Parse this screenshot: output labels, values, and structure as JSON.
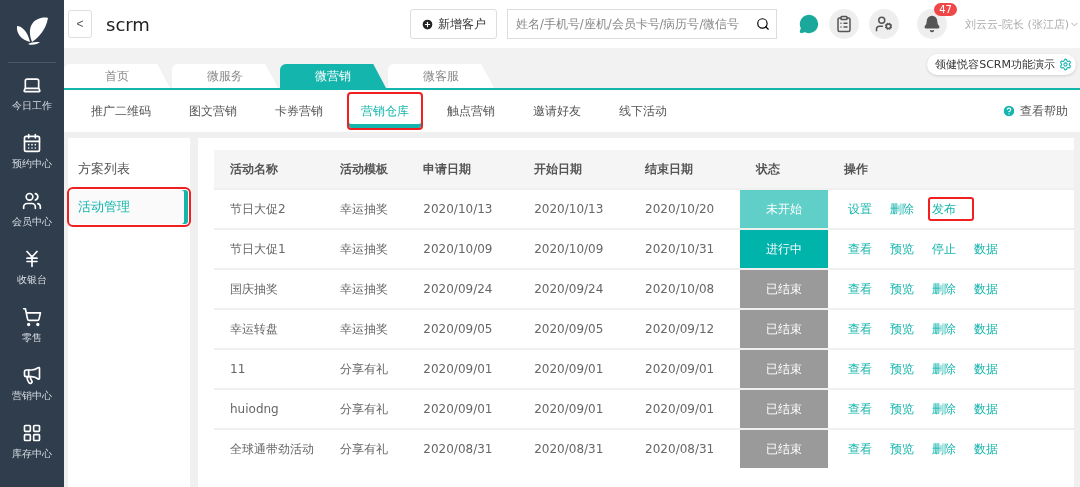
{
  "header": {
    "back": "<",
    "title": "scrm",
    "add_button": "新增客户",
    "search": {
      "placeholder": "姓名/手机号/座机/会员卡号/病历号/微信号"
    },
    "notification_count": "47",
    "user": "刘云云-院长 (张江店)"
  },
  "sidebar": {
    "items": [
      {
        "label": "今日工作"
      },
      {
        "label": "预约中心"
      },
      {
        "label": "会员中心"
      },
      {
        "label": "收银台"
      },
      {
        "label": "零售"
      },
      {
        "label": "营销中心"
      },
      {
        "label": "库存中心"
      }
    ]
  },
  "main_tabs": [
    {
      "label": "首页",
      "selected": false
    },
    {
      "label": "微服务",
      "selected": false
    },
    {
      "label": "微营销",
      "selected": true
    },
    {
      "label": "微客服",
      "selected": false
    }
  ],
  "store_selector": "领健悦容SCRM功能演示",
  "sub_tabs": [
    {
      "label": "推广二维码",
      "selected": false,
      "highlighted": false
    },
    {
      "label": "图文营销",
      "selected": false,
      "highlighted": false
    },
    {
      "label": "卡券营销",
      "selected": false,
      "highlighted": false
    },
    {
      "label": "营销仓库",
      "selected": true,
      "highlighted": true
    },
    {
      "label": "触点营销",
      "selected": false,
      "highlighted": false
    },
    {
      "label": "邀请好友",
      "selected": false,
      "highlighted": false
    },
    {
      "label": "线下活动",
      "selected": false,
      "highlighted": false
    }
  ],
  "help": "查看帮助",
  "side_menu": [
    {
      "label": "方案列表",
      "selected": false,
      "highlighted": false
    },
    {
      "label": "活动管理",
      "selected": true,
      "highlighted": true
    }
  ],
  "table": {
    "columns": [
      "活动名称",
      "活动模板",
      "申请日期",
      "开始日期",
      "结束日期",
      "状态",
      "操作"
    ],
    "rows": [
      {
        "name": "节日大促2",
        "template": "幸运抽奖",
        "applied": "2020/10/13",
        "start": "2020/10/13",
        "end": "2020/10/20",
        "status": {
          "label": "未开始",
          "kind": "pending"
        },
        "actions": [
          {
            "label": "设置",
            "highlighted": false
          },
          {
            "label": "删除",
            "highlighted": false
          },
          {
            "label": "发布",
            "highlighted": true
          }
        ]
      },
      {
        "name": "节日大促1",
        "template": "幸运抽奖",
        "applied": "2020/10/09",
        "start": "2020/10/09",
        "end": "2020/10/31",
        "status": {
          "label": "进行中",
          "kind": "active"
        },
        "actions": [
          {
            "label": "查看",
            "highlighted": false
          },
          {
            "label": "预览",
            "highlighted": false
          },
          {
            "label": "停止",
            "highlighted": false
          },
          {
            "label": "数据",
            "highlighted": false
          }
        ]
      },
      {
        "name": "国庆抽奖",
        "template": "幸运抽奖",
        "applied": "2020/09/24",
        "start": "2020/09/24",
        "end": "2020/10/08",
        "status": {
          "label": "已结束",
          "kind": "ended"
        },
        "actions": [
          {
            "label": "查看",
            "highlighted": false
          },
          {
            "label": "预览",
            "highlighted": false
          },
          {
            "label": "删除",
            "highlighted": false
          },
          {
            "label": "数据",
            "highlighted": false
          }
        ]
      },
      {
        "name": "幸运转盘",
        "template": "幸运抽奖",
        "applied": "2020/09/05",
        "start": "2020/09/05",
        "end": "2020/09/12",
        "status": {
          "label": "已结束",
          "kind": "ended"
        },
        "actions": [
          {
            "label": "查看",
            "highlighted": false
          },
          {
            "label": "预览",
            "highlighted": false
          },
          {
            "label": "删除",
            "highlighted": false
          },
          {
            "label": "数据",
            "highlighted": false
          }
        ]
      },
      {
        "name": "11",
        "template": "分享有礼",
        "applied": "2020/09/01",
        "start": "2020/09/01",
        "end": "2020/09/01",
        "status": {
          "label": "已结束",
          "kind": "ended"
        },
        "actions": [
          {
            "label": "查看",
            "highlighted": false
          },
          {
            "label": "预览",
            "highlighted": false
          },
          {
            "label": "删除",
            "highlighted": false
          },
          {
            "label": "数据",
            "highlighted": false
          }
        ]
      },
      {
        "name": "huiodng",
        "template": "分享有礼",
        "applied": "2020/09/01",
        "start": "2020/09/01",
        "end": "2020/09/01",
        "status": {
          "label": "已结束",
          "kind": "ended"
        },
        "actions": [
          {
            "label": "查看",
            "highlighted": false
          },
          {
            "label": "预览",
            "highlighted": false
          },
          {
            "label": "删除",
            "highlighted": false
          },
          {
            "label": "数据",
            "highlighted": false
          }
        ]
      },
      {
        "name": "全球通带劲活动",
        "template": "分享有礼",
        "applied": "2020/08/31",
        "start": "2020/08/31",
        "end": "2020/08/31",
        "status": {
          "label": "已结束",
          "kind": "ended"
        },
        "actions": [
          {
            "label": "查看",
            "highlighted": false
          },
          {
            "label": "预览",
            "highlighted": false
          },
          {
            "label": "删除",
            "highlighted": false
          },
          {
            "label": "数据",
            "highlighted": false
          }
        ]
      }
    ]
  }
}
